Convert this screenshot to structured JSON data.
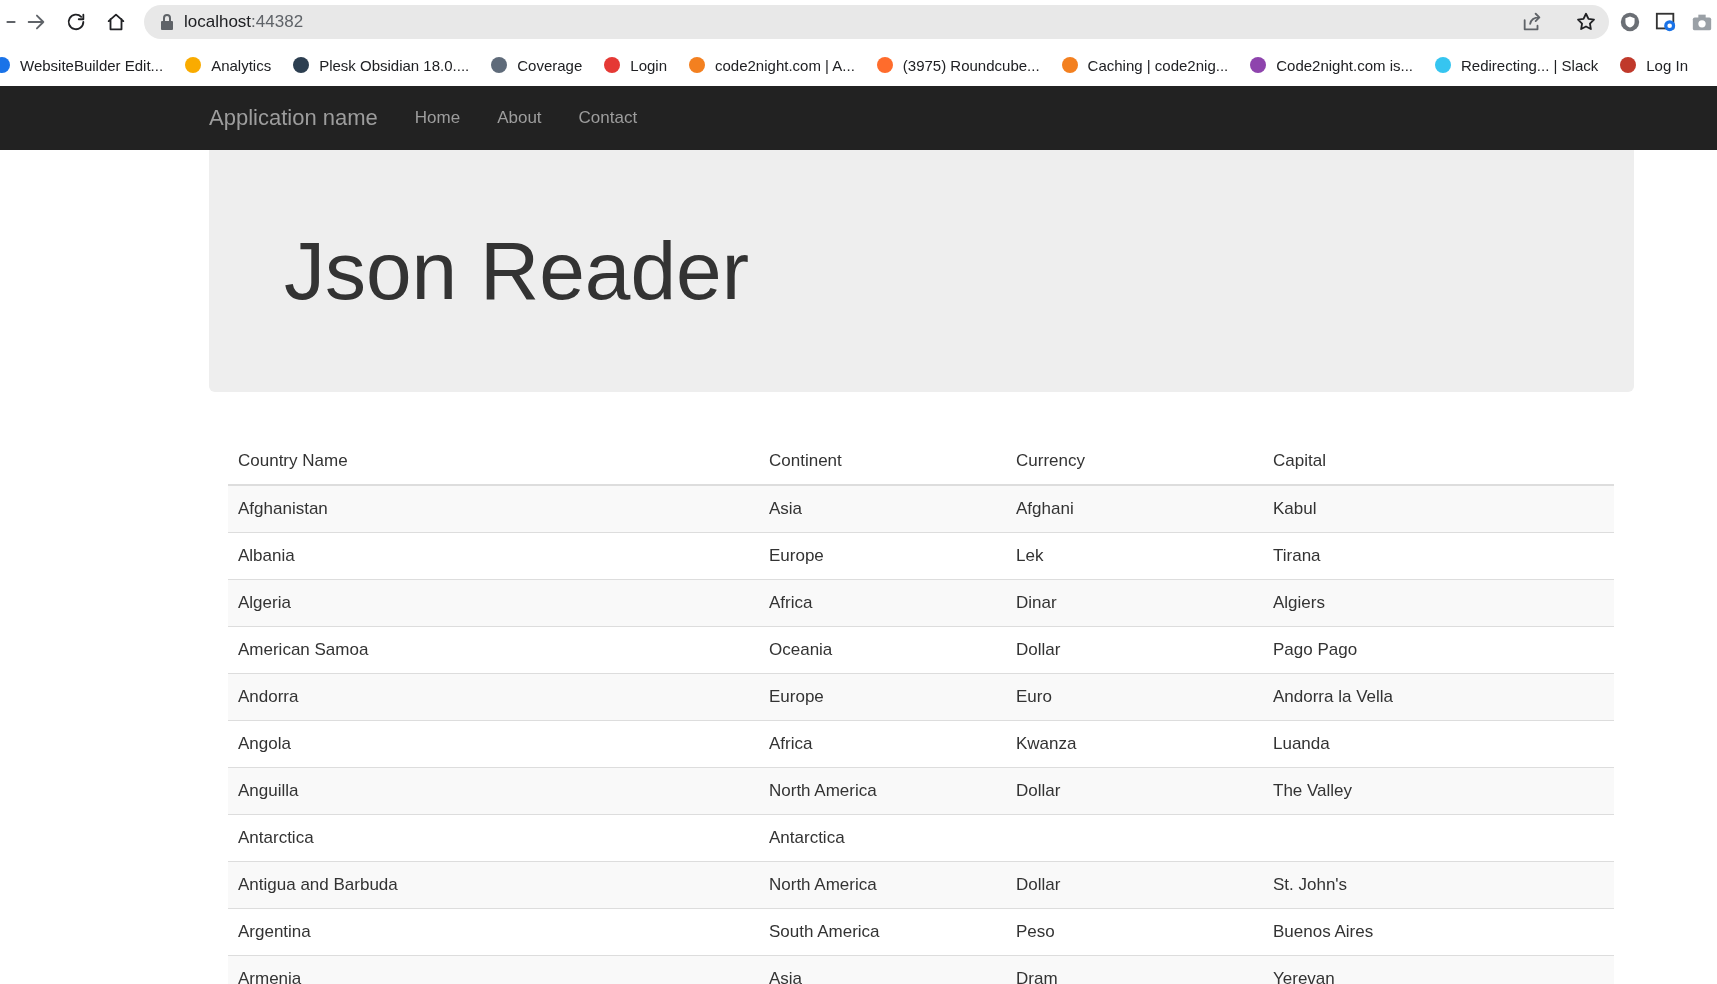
{
  "browser": {
    "url": "localhost",
    "url_port": ":44382"
  },
  "bookmarks": [
    {
      "label": "WebsiteBuilder Edit...",
      "color": "#1a73e8"
    },
    {
      "label": "Analytics",
      "color": "#f9ab00"
    },
    {
      "label": "Plesk Obsidian 18.0....",
      "color": "#2c3e50"
    },
    {
      "label": "Coverage",
      "color": "#5f6b7a"
    },
    {
      "label": "Login",
      "color": "#e53935"
    },
    {
      "label": "code2night.com | A...",
      "color": "#f38020"
    },
    {
      "label": "(3975) Roundcube...",
      "color": "#ff6c2c"
    },
    {
      "label": "Caching | code2nig...",
      "color": "#f38020"
    },
    {
      "label": "Code2night.com is...",
      "color": "#8e44ad"
    },
    {
      "label": "Redirecting... | Slack",
      "color": "#36c5f0"
    },
    {
      "label": "Log In",
      "color": "#c0392b"
    }
  ],
  "navbar": {
    "brand": "Application name",
    "links": [
      "Home",
      "About",
      "Contact"
    ]
  },
  "jumbotron": {
    "title": "Json Reader"
  },
  "table": {
    "columns": [
      "Country Name",
      "Continent",
      "Currency",
      "Capital"
    ],
    "rows": [
      {
        "country": "Afghanistan",
        "continent": "Asia",
        "currency": "Afghani",
        "capital": "Kabul"
      },
      {
        "country": "Albania",
        "continent": "Europe",
        "currency": "Lek",
        "capital": "Tirana"
      },
      {
        "country": "Algeria",
        "continent": "Africa",
        "currency": "Dinar",
        "capital": "Algiers"
      },
      {
        "country": "American Samoa",
        "continent": "Oceania",
        "currency": "Dollar",
        "capital": "Pago Pago"
      },
      {
        "country": "Andorra",
        "continent": "Europe",
        "currency": "Euro",
        "capital": "Andorra la Vella"
      },
      {
        "country": "Angola",
        "continent": "Africa",
        "currency": "Kwanza",
        "capital": "Luanda"
      },
      {
        "country": "Anguilla",
        "continent": "North America",
        "currency": "Dollar",
        "capital": "The Valley"
      },
      {
        "country": "Antarctica",
        "continent": "Antarctica"
      },
      {
        "country": "Antigua and Barbuda",
        "continent": "North America",
        "currency": "Dollar",
        "capital": "St. John's"
      },
      {
        "country": "Argentina",
        "continent": "South America",
        "currency": "Peso",
        "capital": "Buenos Aires"
      },
      {
        "country": "Armenia",
        "continent": "Asia",
        "currency": "Dram",
        "capital": "Yerevan"
      }
    ]
  }
}
